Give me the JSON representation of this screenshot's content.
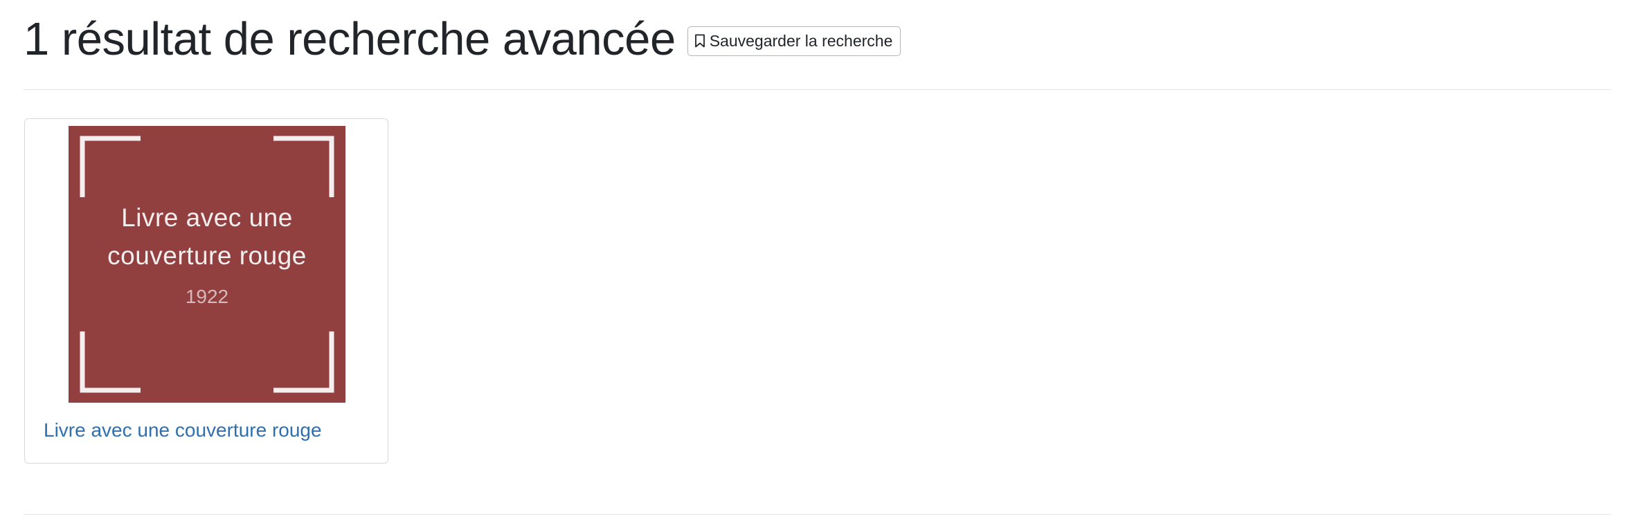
{
  "header": {
    "title": "1 résultat de recherche avancée",
    "save_button": {
      "label": "Sauvegarder la recherche",
      "icon": "bookmark-icon"
    }
  },
  "results": [
    {
      "thumbnail": {
        "title_line_1": "Livre avec une",
        "title_line_2": "couverture rouge",
        "year": "1922",
        "background_color": "#923f40"
      },
      "link_text": "Livre avec une couverture rouge"
    }
  ],
  "colors": {
    "link": "#2f6fb0",
    "text": "#212529",
    "divider": "#e2e5e8"
  }
}
